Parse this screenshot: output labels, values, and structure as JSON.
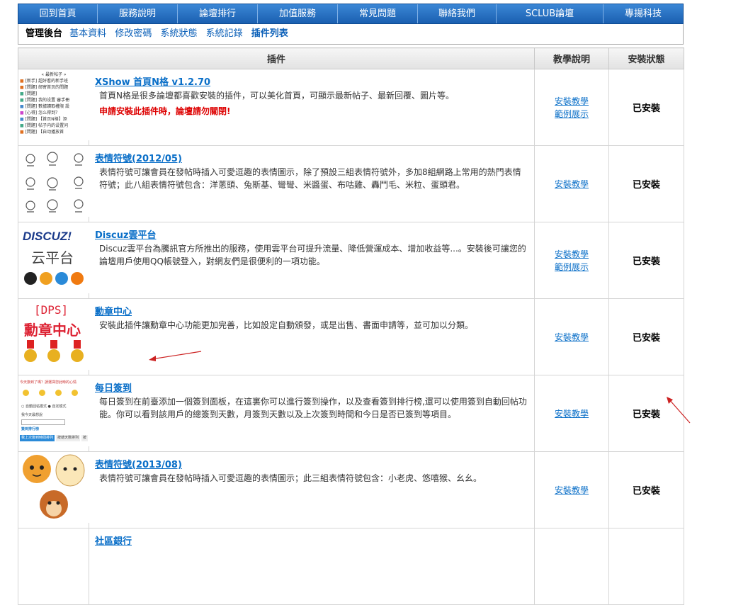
{
  "topnav": [
    "回到首頁",
    "服務說明",
    "論壇排行",
    "加值服務",
    "常見問題",
    "聯絡我們",
    "SCLUB論壇",
    "專揚科技"
  ],
  "subnav": {
    "title": "管理後台",
    "links": [
      "基本資料",
      "修改密碼",
      "系統狀態",
      "系統記錄",
      "插件列表"
    ]
  },
  "table": {
    "headers": [
      "插件",
      "教學說明",
      "安裝狀態"
    ]
  },
  "plugins": [
    {
      "title": "XShow 首頁N格 v1.2.70",
      "desc": "首頁N格是很多論壇都喜歡安裝的插件，可以美化首頁，可顯示最新帖子、最新回覆、圖片等。",
      "warn": "申請安裝此插件時，論壇請勿關閉!",
      "tutorial": "安裝教學",
      "demo": "範例展示",
      "status": "已安裝",
      "thumb_lines": [
        "« 最新帖子 »",
        "[新手] 超好看的新手班",
        "[問題] 邮寄首页的問題",
        "[問題]",
        "[問題] 我的设置 審手冊",
        "[問題] 數據讀取權限 設",
        "[心得] 怎么得到？",
        "[問題] 【首页N格】添",
        "[問題] 帖子内的设置问",
        "[問題] 【自动播放首"
      ]
    },
    {
      "title": "表情符號(2012/05)",
      "desc": "表情符號可讓會員在發帖時插入可愛逗趣的表情圖示，除了預設三組表情符號外，多加8組網路上常用的熱門表情符號；此八組表情符號包含：洋蔥頭、兔斯基、彎彎、米醬蛋、布咕雞、轟鬥毛、米粒、蛋頭君。",
      "warn": "",
      "tutorial": "安裝教學",
      "demo": "",
      "status": "已安裝"
    },
    {
      "title": "Discuz雲平台",
      "desc": "Discuz雲平台為騰訊官方所推出的服務，使用雲平台可提升流量、降低營運成本、增加收益等...。安裝後可讓您的論壇用戶使用QQ帳號登入，對網友們是很便利的一項功能。",
      "warn": "",
      "tutorial": "安裝教學",
      "demo": "範例展示",
      "status": "已安裝",
      "thumb_lines": [
        "DISCUZ!",
        "云平台"
      ]
    },
    {
      "title": "勳章中心",
      "desc": "安裝此插件讓勳章中心功能更加完善，比如設定自動頒發，或是出售、書面申請等，並可加以分類。",
      "warn": "",
      "tutorial": "安裝教學",
      "demo": "",
      "status": "已安裝",
      "thumb_lines": [
        "[DPS]",
        "勳章中心"
      ]
    },
    {
      "title": "每日簽到",
      "desc": "每日簽到在前臺添加一個簽到面板，在這裏你可以進行簽到操作，以及查看簽到排行榜,還可以使用簽到自動回帖功能。你可以看到該用戶的總簽到天數，月簽到天數以及上次簽到時間和今日是否已簽到等項目。",
      "warn": "",
      "tutorial": "安裝教學",
      "demo": "",
      "status": "已安裝",
      "thumb_lines": [
        "今天簽到了嗎？請選擇您此時的心情",
        "自動回帖模式",
        "自定模式",
        "我今天最想說",
        "簽到排行榜",
        "我上次簽到時間排列",
        "按總天數排列",
        "按"
      ]
    },
    {
      "title": "表情符號(2013/08)",
      "desc": "表情符號可讓會員在發帖時插入可愛逗趣的表情圖示；此三組表情符號包含：小老虎、悠嘻猴、幺幺。",
      "warn": "",
      "tutorial": "安裝教學",
      "demo": "",
      "status": "已安裝"
    },
    {
      "title": "社區銀行",
      "desc": "",
      "warn": "",
      "tutorial": "",
      "demo": "",
      "status": ""
    }
  ],
  "colors": {
    "nav": "#1a5fb0",
    "link": "#0a6fc8",
    "warn": "#dd0000",
    "arrow": "#cc2222"
  }
}
